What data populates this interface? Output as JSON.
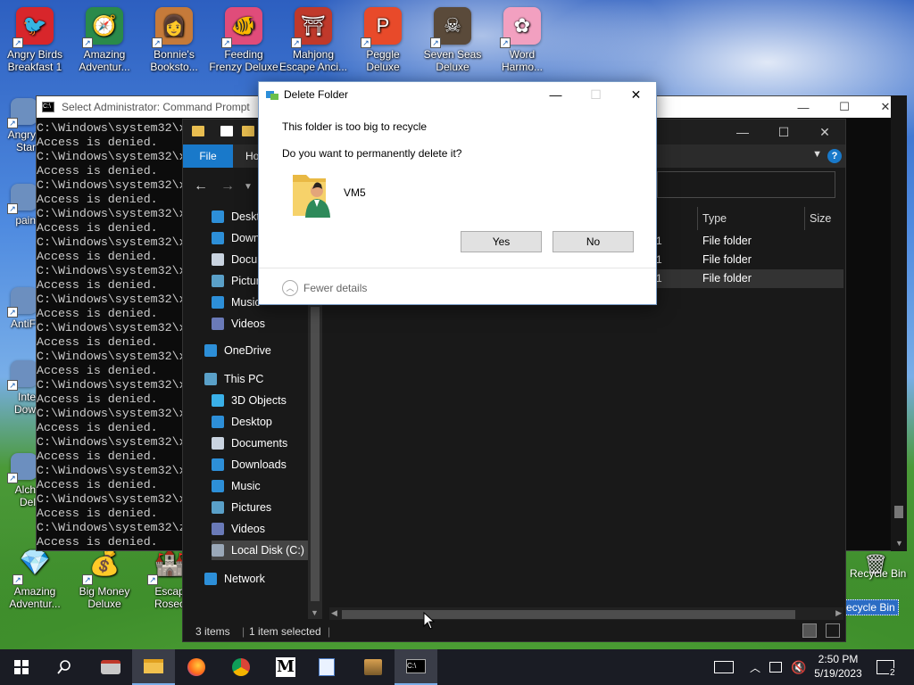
{
  "desktop": {
    "icons": [
      {
        "label1": "Angry Birds",
        "label2": "Breakfast 1",
        "icon": "angry-birds-icon",
        "color": "#d8262b",
        "glyph": "🐦"
      },
      {
        "label1": "Amazing",
        "label2": "Adventur...",
        "icon": "compass-icon",
        "color": "#2a8a4a",
        "glyph": "🧭"
      },
      {
        "label1": "Bonnie's",
        "label2": "Booksto...",
        "icon": "bonnie-icon",
        "color": "#c57a3a",
        "glyph": "👩"
      },
      {
        "label1": "Feeding",
        "label2": "Frenzy Deluxe",
        "icon": "fish-icon",
        "color": "#e04c7a",
        "glyph": "🐠"
      },
      {
        "label1": "Mahjong",
        "label2": "Escape Anci...",
        "icon": "torii-icon",
        "color": "#c0392b",
        "glyph": "⛩"
      },
      {
        "label1": "Peggle",
        "label2": "Deluxe",
        "icon": "peggle-icon",
        "color": "#e84a2a",
        "glyph": "P"
      },
      {
        "label1": "Seven Seas",
        "label2": "Deluxe",
        "icon": "skull-icon",
        "color": "#5a4a3a",
        "glyph": "☠"
      },
      {
        "label1": "Word",
        "label2": "Harmo...",
        "icon": "flower-icon",
        "color": "#f2a0c0",
        "glyph": "✿"
      }
    ],
    "left_icons": [
      {
        "label1": "Angry",
        "label2": "Star",
        "icon": "angry-birds-star-icon"
      },
      {
        "label1": "pain",
        "label2": "",
        "icon": "paint-icon"
      },
      {
        "label1": "AntiF",
        "label2": "",
        "icon": "antif-icon"
      },
      {
        "label1": "Inte",
        "label2": "Dow",
        "icon": "internet-download-icon"
      },
      {
        "label1": "Alch",
        "label2": "Del",
        "icon": "alchemy-icon"
      }
    ],
    "bottom_icons": [
      {
        "label1": "Amazing",
        "label2": "Adventur...",
        "icon": "diamond-icon",
        "glyph": "💎"
      },
      {
        "label1": "Big Money",
        "label2": "Deluxe",
        "icon": "money-bag-icon",
        "glyph": "💰"
      },
      {
        "label1": "Escap",
        "label2": "Rosec",
        "icon": "escape-rosecliff-icon",
        "glyph": "🏰"
      }
    ],
    "recycle_bin_label": "Recycle Bin",
    "recycle_bin_label_partial": "ecycle Bin"
  },
  "cmd": {
    "title": "Select Administrator: Command Prompt",
    "prompt_line": "C:\\Windows\\system32\\x",
    "denied_line": "Access is denied.",
    "last_prompt": "C:\\Windows\\system32\\z"
  },
  "explorer": {
    "ribbon": {
      "file": "File",
      "home": "Ho"
    },
    "nav": {
      "quick": [
        "Deskt",
        "Down",
        "Docu",
        "Pictur",
        "Music",
        "Videos"
      ],
      "onedrive": "OneDrive",
      "thispc": "This PC",
      "pc_items": [
        "3D Objects",
        "Desktop",
        "Documents",
        "Downloads",
        "Music",
        "Pictures",
        "Videos"
      ],
      "local_disk": "Local Disk (C:)",
      "network": "Network"
    },
    "columns": {
      "type": "Type",
      "size": "Size"
    },
    "rows": [
      {
        "type": "File folder",
        "partial": "1"
      },
      {
        "type": "File folder",
        "partial": "1"
      },
      {
        "type": "File folder",
        "partial": "1"
      }
    ],
    "status": {
      "items": "3 items",
      "selected": "1 item selected"
    }
  },
  "dialog": {
    "title": "Delete Folder",
    "line1": "This folder is too big to recycle",
    "line2": "Do you want to permanently delete it?",
    "folder_name": "VM5",
    "yes": "Yes",
    "no": "No",
    "details": "Fewer details"
  },
  "taskbar": {
    "time": "2:50 PM",
    "date": "5/19/2023",
    "notifications": "2",
    "apps": [
      "windows-start-icon",
      "search-icon",
      "ie-cleaner-icon",
      "file-explorer-icon",
      "firefox-icon",
      "chrome-icon",
      "m-app-icon",
      "notepad-icon",
      "winrar-icon",
      "cmd-icon"
    ]
  }
}
